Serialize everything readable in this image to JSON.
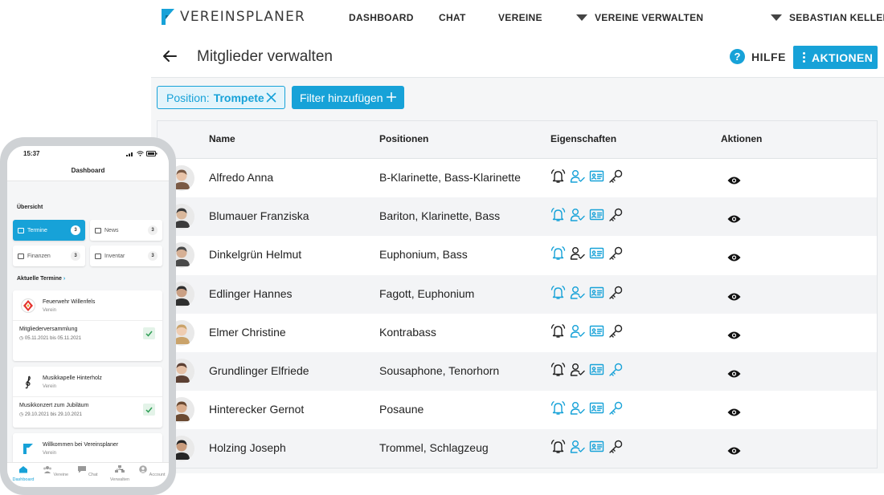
{
  "app": {
    "logo_text": "VEREINSPLANER",
    "nav": [
      "DASHBOARD",
      "CHAT",
      "VEREINE"
    ],
    "nav_dropdown": "VEREINE VERWALTEN",
    "user_menu": "SEBASTIAN KELLER",
    "accent_color": "#17a2d8"
  },
  "page": {
    "title": "Mitglieder verwalten",
    "help_label": "HILFE",
    "actions_label": "AKTIONEN"
  },
  "filters": {
    "active_key": "Position:",
    "active_value": "Trompete",
    "add_label": "Filter hinzufügen"
  },
  "table": {
    "headers": [
      "Name",
      "Positionen",
      "Eigenschaften",
      "Aktionen"
    ],
    "rows": [
      {
        "name": "Alfredo Anna",
        "positions": "B-Klarinette, Bass-Klarinette",
        "props": [
          false,
          true,
          true,
          false
        ]
      },
      {
        "name": "Blumauer Franziska",
        "positions": "Bariton, Klarinette, Bass",
        "props": [
          true,
          true,
          true,
          false
        ]
      },
      {
        "name": "Dinkelgrün Helmut",
        "positions": "Euphonium, Bass",
        "props": [
          true,
          false,
          true,
          false
        ]
      },
      {
        "name": "Edlinger Hannes",
        "positions": "Fagott, Euphonium",
        "props": [
          true,
          true,
          true,
          false
        ]
      },
      {
        "name": "Elmer Christine",
        "positions": "Kontrabass",
        "props": [
          false,
          true,
          true,
          false
        ]
      },
      {
        "name": "Grundlinger Elfriede",
        "positions": "Sousaphone, Tenorhorn",
        "props": [
          false,
          false,
          true,
          true
        ]
      },
      {
        "name": "Hinterecker Gernot",
        "positions": "Posaune",
        "props": [
          true,
          true,
          true,
          true
        ]
      },
      {
        "name": "Holzing Joseph",
        "positions": "Trommel, Schlagzeug",
        "props": [
          false,
          true,
          true,
          false
        ]
      }
    ],
    "icon_names": [
      "bell-icon",
      "user-check-icon",
      "id-card-icon",
      "key-icon"
    ],
    "action_icon": "eye-icon"
  },
  "mobile": {
    "time": "15:37",
    "header": "Dashboard",
    "overview_title": "Übersicht",
    "tiles": [
      {
        "label": "Termine",
        "count": "3"
      },
      {
        "label": "News",
        "count": "3"
      },
      {
        "label": "Finanzen",
        "count": "3"
      },
      {
        "label": "Inventar",
        "count": "3"
      }
    ],
    "events_title": "Aktuelle Termine",
    "cards": [
      {
        "org": "Feuerwehr Willenfels",
        "type": "Verein",
        "event": "Mitgliederversammlung",
        "date": "05.11.2021 bis 05.11.2021"
      },
      {
        "org": "Musikkapelle Hinterholz",
        "type": "Verein",
        "event": "Musikkonzert zum Jubiläum",
        "date": "29.10.2021 bis 29.10.2021"
      },
      {
        "org": "Willkommen bei Vereinsplaner",
        "type": "Verein"
      }
    ],
    "tabs": [
      "Dashboard",
      "Vereine",
      "Chat",
      "Verwalten",
      "Account"
    ]
  }
}
